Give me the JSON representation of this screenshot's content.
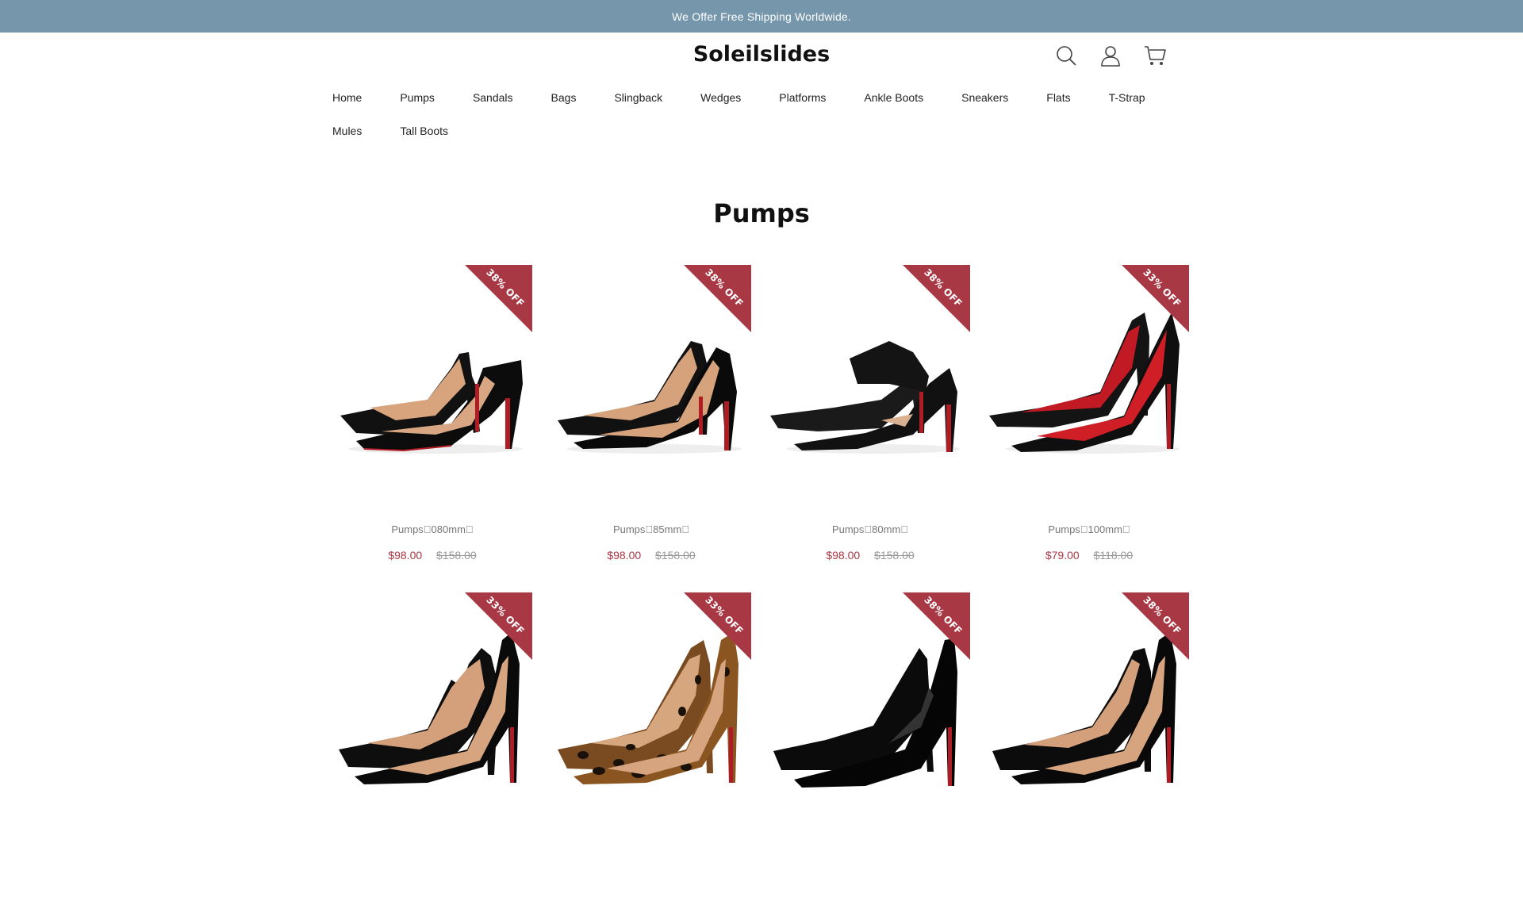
{
  "announcement": "We Offer Free Shipping Worldwide.",
  "store_name": "Soleilslides",
  "header_icons": [
    "search-icon",
    "account-icon",
    "cart-icon"
  ],
  "nav": {
    "row1": [
      "Home",
      "Pumps",
      "Sandals",
      "Bags",
      "Slingback",
      "Wedges",
      "Platforms",
      "Ankle Boots",
      "Sneakers",
      "Flats",
      "T-Strap"
    ],
    "row2": [
      "Mules",
      "Tall Boots"
    ]
  },
  "collection_title": "Pumps",
  "colors": {
    "announcement_bg": "#7596ab",
    "badge": "#a93845",
    "sale_price": "#a93845"
  },
  "products": [
    {
      "badge": "38% OFF",
      "name": "Pumps\u0000080mm\u0000",
      "price": "$98.00",
      "compare_price": "$158.00"
    },
    {
      "badge": "38% OFF",
      "name": "Pumps\u000085mm\u0000",
      "price": "$98.00",
      "compare_price": "$158.00"
    },
    {
      "badge": "38% OFF",
      "name": "Pumps\u000080mm\u0000",
      "price": "$98.00",
      "compare_price": "$158.00"
    },
    {
      "badge": "33% OFF",
      "name": "Pumps\u0000100mm\u0000",
      "price": "$79.00",
      "compare_price": "$118.00"
    },
    {
      "badge": "33% OFF"
    },
    {
      "badge": "33% OFF"
    },
    {
      "badge": "38% OFF"
    },
    {
      "badge": "38% OFF"
    }
  ]
}
